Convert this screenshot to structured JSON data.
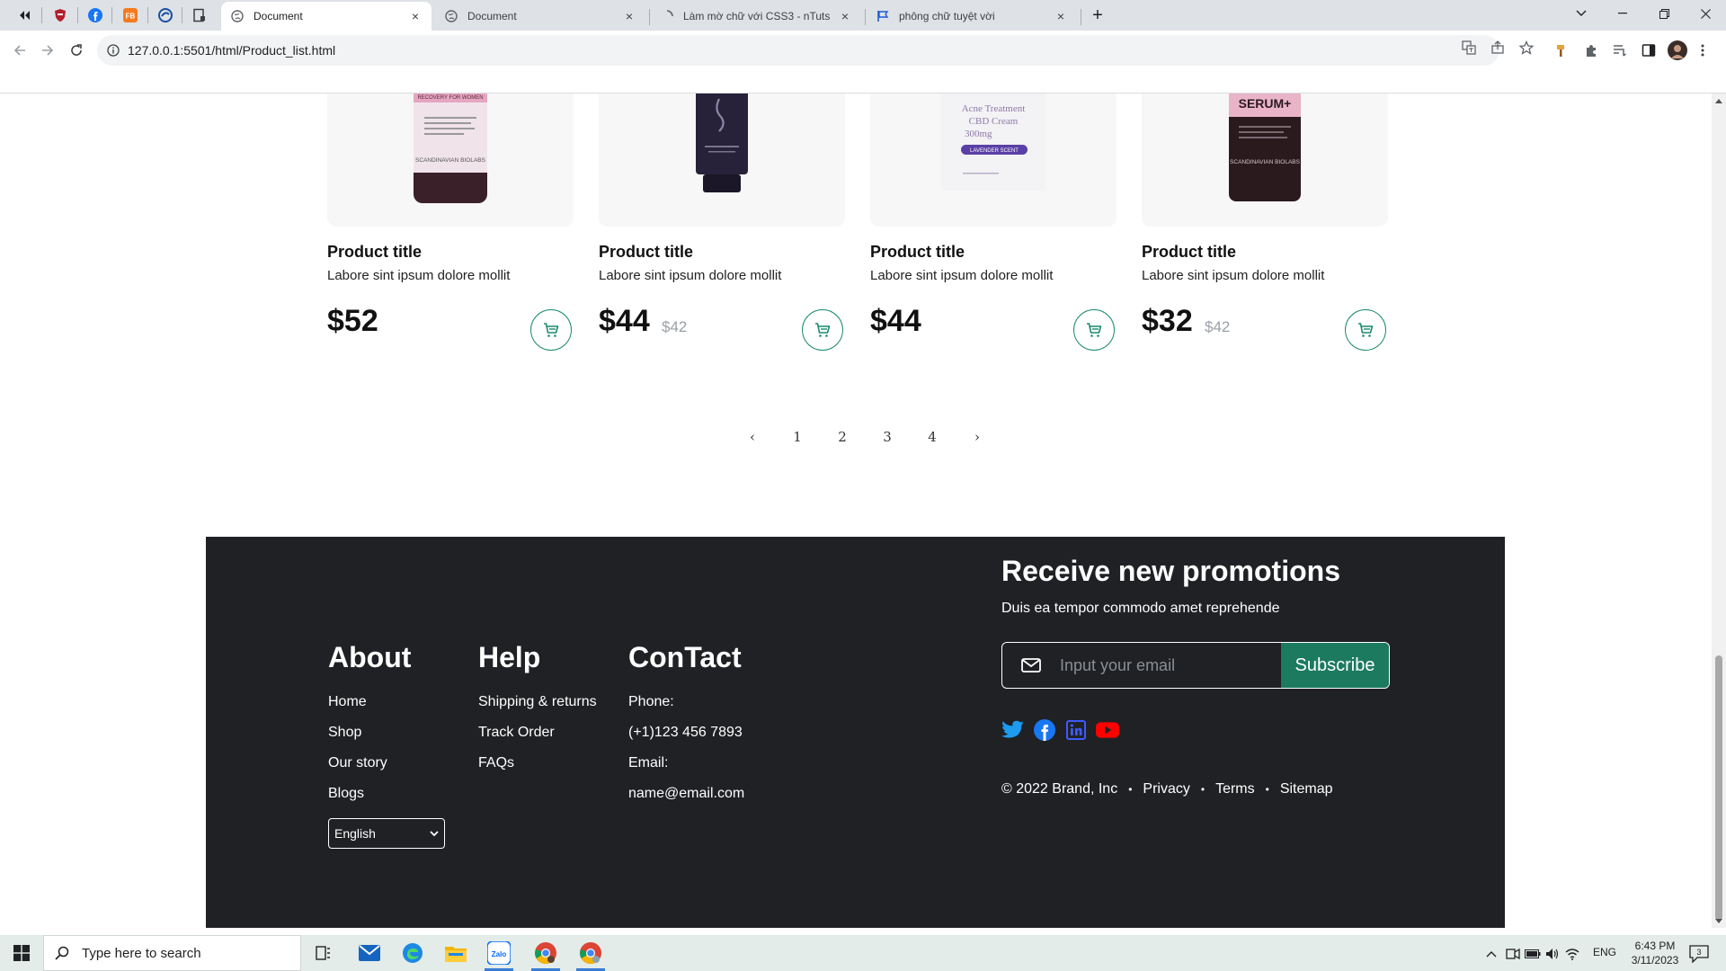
{
  "browser": {
    "tabs": [
      {
        "label": "Document",
        "active": true
      },
      {
        "label": "Document",
        "active": false
      },
      {
        "label": "Làm mờ chữ với CSS3 - nTuts",
        "active": false
      },
      {
        "label": "phông chữ tuyệt vời",
        "active": false
      }
    ],
    "pinned_icons": [
      "media-back-icon",
      "shield-extension-icon",
      "facebook-icon",
      "fb-tool-icon",
      "browser-extension-icon",
      "document-extension-icon"
    ],
    "pinned_fb_label": "FB",
    "url": "127.0.0.1:5501/html/Product_list.html",
    "tab_close": "×",
    "new_tab": "+"
  },
  "products": [
    {
      "title": "Product title",
      "desc": "Labore sint ipsum dolore mollit",
      "price": "$52",
      "old_price": "",
      "image": "serum-bottle-pink-label"
    },
    {
      "title": "Product title",
      "desc": "Labore sint ipsum dolore mollit",
      "price": "$44",
      "old_price": "$42",
      "image": "dark-purple-tube"
    },
    {
      "title": "Product title",
      "desc": "Labore sint ipsum dolore mollit",
      "price": "$44",
      "old_price": "",
      "image": "acne-cream-box"
    },
    {
      "title": "Product title",
      "desc": "Labore sint ipsum dolore mollit",
      "price": "$32",
      "old_price": "$42",
      "image": "serum-bottle-black"
    }
  ],
  "product_images": {
    "p1": {
      "brand": "SCANDINAVIAN BIOLABS",
      "line": "RECOVERY FOR WOMEN"
    },
    "p3": {
      "line1": "Acne Treatment",
      "line2": "CBD Cream",
      "line3": "300mg",
      "badge": "LAVENDER SCENT"
    },
    "p4": {
      "name": "SERUM+",
      "brand": "SCANDINAVIAN BIOLABS"
    }
  },
  "pagination": {
    "prev": "‹",
    "pages": [
      "1",
      "2",
      "3",
      "4"
    ],
    "next": "›"
  },
  "footer": {
    "about": {
      "heading": "About",
      "links": [
        "Home",
        "Shop",
        "Our story",
        "Blogs"
      ]
    },
    "help": {
      "heading": "Help",
      "links": [
        "Shipping & returns",
        "Track Order",
        "FAQs"
      ]
    },
    "contact": {
      "heading": "ConTact",
      "lines": [
        "Phone:",
        "(+1)123 456 7893",
        "Email:",
        "name@email.com"
      ]
    },
    "language": "English",
    "promo_title": "Receive new promotions",
    "promo_sub": "Duis ea tempor commodo amet reprehende",
    "email_placeholder": "Input your email",
    "subscribe": "Subscribe",
    "social": [
      "twitter-icon",
      "facebook-icon",
      "linkedin-icon",
      "youtube-icon"
    ],
    "legal": {
      "copyright": "© 2022 Brand, Inc",
      "items": [
        "Privacy",
        "Terms",
        "Sitemap"
      ],
      "separator": "•"
    }
  },
  "taskbar": {
    "search_placeholder": "Type here to search",
    "zalo_label": "Zalo",
    "lang": "ENG",
    "time": "6:43 PM",
    "date": "3/11/2023",
    "notification_count": "3"
  },
  "colors": {
    "accent_green": "#1c7a5f",
    "footer_bg": "#1f2124",
    "twitter": "#1d9bf0",
    "facebook": "#1877f2",
    "linkedin": "#3d5afe",
    "youtube": "#ff0000"
  }
}
